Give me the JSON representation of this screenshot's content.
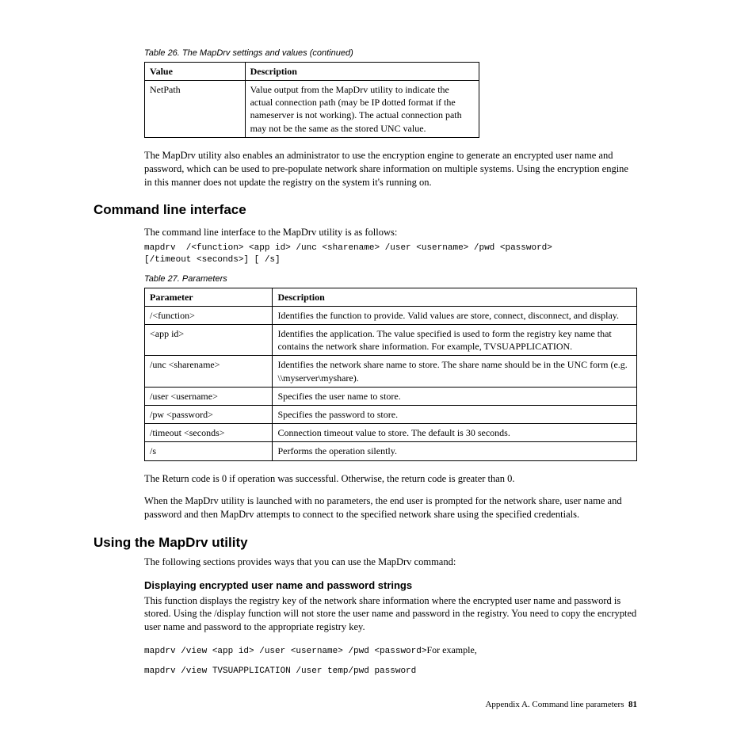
{
  "table26": {
    "caption": "Table 26. The MapDrv settings and values  (continued)",
    "headers": [
      "Value",
      "Description"
    ],
    "rows": [
      {
        "c0": "NetPath",
        "c1": "Value output from the MapDrv utility to indicate the actual connection path (may be IP dotted format if the nameserver is not working). The actual connection path may not be the same as the stored UNC value."
      }
    ]
  },
  "para_after_t26": "The MapDrv utility also enables an administrator to use the encryption engine to generate an encrypted user name and password, which can be used to pre-populate network share information on multiple systems. Using the encryption engine in this manner does not update the registry on the system it's running on.",
  "cli": {
    "heading": "Command line interface",
    "intro": "The command line interface to the MapDrv utility is as follows:",
    "code": "mapdrv  /<function> <app id> /unc <sharename> /user <username> /pwd <password>\n[/timeout <seconds>] [ /s]"
  },
  "table27": {
    "caption": "Table 27. Parameters",
    "headers": [
      "Parameter",
      "Description"
    ],
    "rows": [
      {
        "c0": "/<function>",
        "c1": "Identifies the function to provide. Valid values are store, connect, disconnect, and display."
      },
      {
        "c0": "<app id>",
        "c1": "Identifies the application. The value specified is used to form the registry key name that contains the network share information. For example, TVSUAPPLICATION."
      },
      {
        "c0": "/unc <sharename>",
        "c1": "Identifies the network share name to store. The share name should be in the UNC form (e.g. \\\\myserver\\myshare)."
      },
      {
        "c0": "/user <username>",
        "c1": "Specifies the user name to store."
      },
      {
        "c0": "/pw <password>",
        "c1": "Specifies the password to store."
      },
      {
        "c0": "/timeout <seconds>",
        "c1": "Connection timeout value to store. The default is 30 seconds."
      },
      {
        "c0": "/s",
        "c1": "Performs the operation silently."
      }
    ]
  },
  "para_return": "The Return code is 0 if operation was successful. Otherwise, the return code is greater than 0.",
  "para_launch": "When the MapDrv utility is launched with no parameters, the end user is prompted for the network share, user name and password and then MapDrv attempts to connect to the specified network share using the specified credentials.",
  "using": {
    "heading": "Using the MapDrv utility",
    "intro": "The following sections provides ways that you can use the MapDrv command:",
    "sub_heading": "Displaying encrypted user name and password strings",
    "sub_para": "This function displays the registry key of the network share information where the encrypted user name and password is stored. Using the /display function will not store the user name and password in the registry. You need to copy the encrypted user name and password to the appropriate registry key.",
    "code1_mono": "mapdrv /view <app id> /user <username> /pwd <password>",
    "code1_tail": "For example,",
    "code2": "mapdrv /view TVSUAPPLICATION /user temp/pwd password"
  },
  "footer": {
    "text": "Appendix A. Command line parameters",
    "page": "81"
  }
}
